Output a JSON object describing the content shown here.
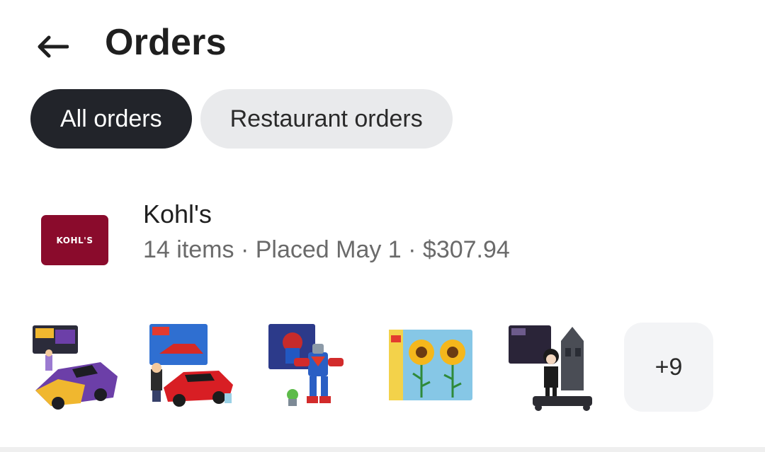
{
  "header": {
    "back_icon": "arrow-left-icon",
    "title": "Orders"
  },
  "filters": {
    "chips": [
      {
        "label": "All orders",
        "active": true
      },
      {
        "label": "Restaurant orders",
        "active": false
      }
    ]
  },
  "order": {
    "store_name": "Kohl's",
    "logo_text": "KOHL'S",
    "logo_color": "#8a0b2c",
    "meta": "14 items · Placed May 1 · $307.94",
    "thumbnails": [
      {
        "name": "lego-race-car-purple-yellow"
      },
      {
        "name": "lego-red-sports-car"
      },
      {
        "name": "lego-superman-mech"
      },
      {
        "name": "lego-sunflowers"
      },
      {
        "name": "lego-wednesday-addams-set"
      }
    ],
    "more_count": "+9"
  },
  "colors": {
    "active_chip_bg": "#22242a",
    "inactive_chip_bg": "#e9eaec",
    "muted_text": "#6a6a6a"
  }
}
